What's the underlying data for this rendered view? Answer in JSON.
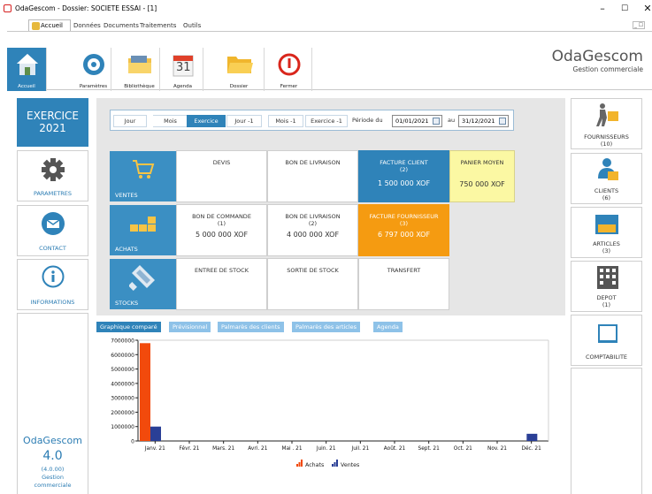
{
  "window": {
    "title": "OdaGescom - Dossier: SOCIETE ESSAI - [1]",
    "minimize": "–",
    "maximize": "☐",
    "close": "✕"
  },
  "menu": {
    "active": "Accueil",
    "items": [
      "Données",
      "Documents",
      "Traitements",
      "Outils"
    ],
    "restore": "_ ☐"
  },
  "ribbon": {
    "buttons": [
      "Accueil",
      "Paramètres",
      "Bibliothèque",
      "Agenda",
      "Dossier",
      "Fermer"
    ],
    "agenda_day": "31",
    "brand_title": "OdaGescom",
    "brand_subtitle": "Gestion commerciale"
  },
  "left": {
    "exercise_label": "EXERCICE",
    "exercise_year": "2021",
    "cards": [
      "PARAMETRES",
      "CONTACT",
      "INFORMATIONS"
    ],
    "footer": {
      "app": "OdaGescom",
      "version": "4.0",
      "build": "(4.0.00)",
      "line1": "Gestion",
      "line2": "commerciale"
    }
  },
  "period": {
    "buttons": [
      "Jour",
      "Mois",
      "Exercice",
      "Jour -1",
      "Mois -1",
      "Exercice -1"
    ],
    "selected": "Exercice",
    "from_label": "Période du",
    "from_date": "01/01/2021",
    "to_label": "au",
    "to_date": "31/12/2021"
  },
  "rows": [
    {
      "label": "VENTES",
      "tiles": [
        {
          "title": "DEVIS",
          "count": "",
          "amount": "",
          "style": "white"
        },
        {
          "title": "BON DE LIVRAISON",
          "count": "",
          "amount": "",
          "style": "white"
        },
        {
          "title": "FACTURE CLIENT",
          "count": "(2)",
          "amount": "1 500 000 XOF",
          "style": "blue"
        },
        {
          "title": "PANIER MOYEN",
          "count": "",
          "amount": "750 000 XOF",
          "style": "yellow"
        }
      ]
    },
    {
      "label": "ACHATS",
      "tiles": [
        {
          "title": "BON DE COMMANDE",
          "count": "(1)",
          "amount": "5 000 000 XOF",
          "style": "white"
        },
        {
          "title": "BON DE LIVRAISON",
          "count": "(2)",
          "amount": "4 000 000 XOF",
          "style": "white"
        },
        {
          "title": "FACTURE FOURNISSEUR",
          "count": "(3)",
          "amount": "6 797 000 XOF",
          "style": "orange"
        }
      ]
    },
    {
      "label": "STOCKS",
      "tiles": [
        {
          "title": "ENTREE DE STOCK",
          "count": "",
          "amount": "",
          "style": "white"
        },
        {
          "title": "SORTIE DE STOCK",
          "count": "",
          "amount": "",
          "style": "white"
        },
        {
          "title": "TRANSFERT",
          "count": "",
          "amount": "",
          "style": "white"
        }
      ]
    }
  ],
  "tabs": [
    "Graphique comparé",
    "Prévisionnel",
    "Palmarès des clients",
    "Palmarès des articles",
    "Agenda"
  ],
  "right": [
    {
      "label": "FOURNISSEURS",
      "count": "(10)"
    },
    {
      "label": "CLIENTS",
      "count": "(6)"
    },
    {
      "label": "ARTICLES",
      "count": "(3)"
    },
    {
      "label": "DEPOT",
      "count": "(1)"
    },
    {
      "label": "COMPTABILITE",
      "count": ""
    }
  ],
  "colors": {
    "accent": "#2f83b9",
    "achats": "#f24a0c",
    "ventes": "#2a3f96",
    "yellow": "#fbf8a3",
    "orange": "#f59b11"
  },
  "chart_data": {
    "type": "bar",
    "categories": [
      "Janv. 21",
      "Févr. 21",
      "Mars. 21",
      "Avri. 21",
      "Mai . 21",
      "Juin. 21",
      "Juil. 21",
      "Août. 21",
      "Sept. 21",
      "Oct. 21",
      "Nov. 21",
      "Déc. 21"
    ],
    "series": [
      {
        "name": "Achats",
        "values": [
          6797000,
          0,
          0,
          0,
          0,
          0,
          0,
          0,
          0,
          0,
          0,
          0
        ]
      },
      {
        "name": "Ventes",
        "values": [
          1000000,
          0,
          0,
          0,
          0,
          0,
          0,
          0,
          0,
          0,
          0,
          500000
        ]
      }
    ],
    "y_ticks": [
      "7000000",
      "6000000",
      "5000000",
      "4000000",
      "3000000",
      "2000000",
      "1000000",
      "0"
    ],
    "ylim": [
      0,
      7000000
    ],
    "grid": false,
    "legend": "bottom-center"
  }
}
